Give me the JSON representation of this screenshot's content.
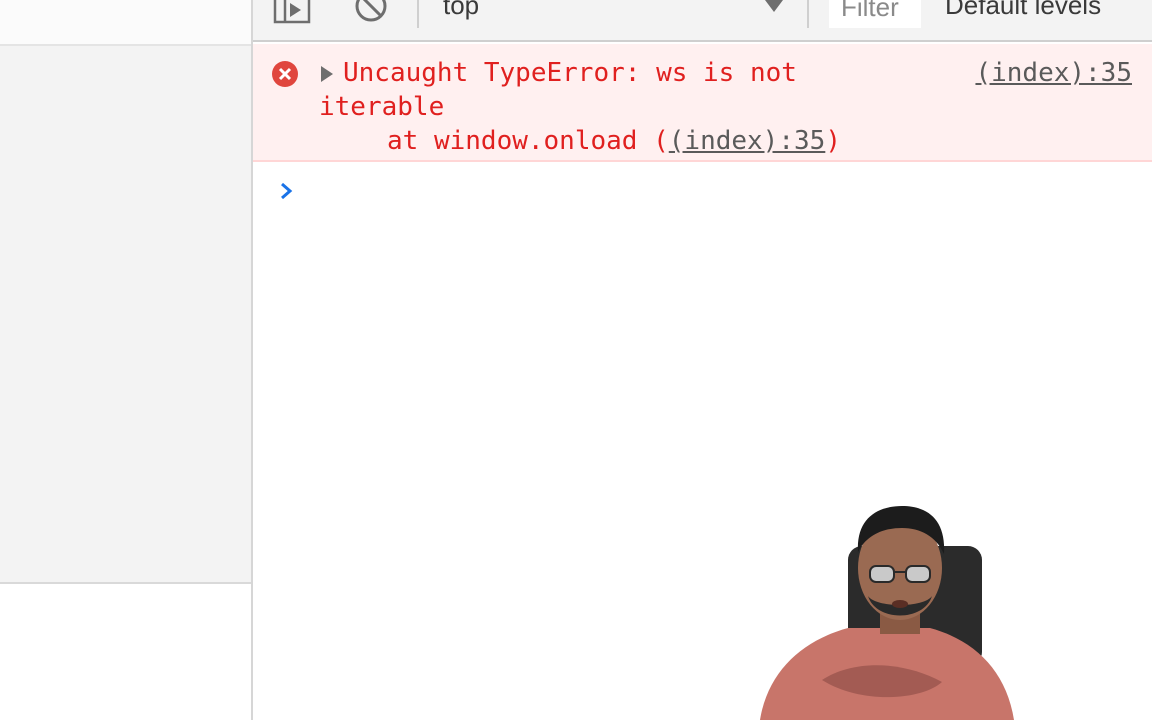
{
  "toolbar": {
    "context": "top",
    "filter_placeholder": "Filter",
    "levels": "Default levels"
  },
  "console": {
    "error": {
      "line1": "Uncaught TypeError: ws is not",
      "line2": "iterable",
      "line3_prefix": "at window.onload (",
      "line3_link": "(index):35",
      "line3_suffix": ")",
      "source": "(index):35"
    }
  },
  "colors": {
    "error_text": "#e0201f",
    "error_bg": "#fff0f0",
    "prompt": "#1a73e8"
  },
  "icons": {
    "sidebar": "sidebar-toggle-icon",
    "clear": "clear-console-icon",
    "error": "error-circle-icon",
    "expand": "expand-triangle-icon",
    "prompt": "prompt-chevron-icon"
  }
}
